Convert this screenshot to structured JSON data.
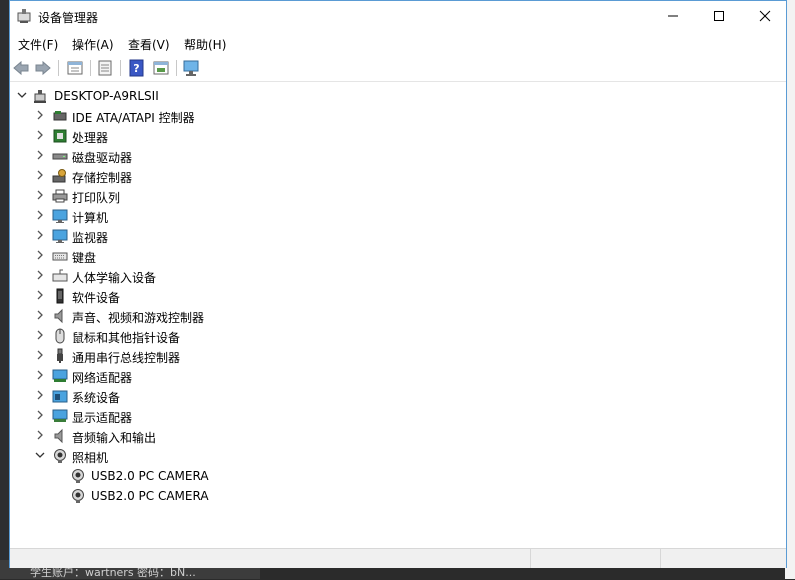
{
  "window": {
    "title": "设备管理器"
  },
  "menu": [
    "文件(F)",
    "操作(A)",
    "查看(V)",
    "帮助(H)"
  ],
  "toolbar_icons": [
    "back-icon",
    "forward-icon",
    "properties-view-icon",
    "document-icon",
    "help-icon",
    "update-driver-icon",
    "scan-hardware-icon"
  ],
  "tree": {
    "root": "DESKTOP-A9RLSII",
    "categories": [
      {
        "label": "IDE ATA/ATAPI 控制器",
        "icon": "ide-controller-icon",
        "expanded": false
      },
      {
        "label": "处理器",
        "icon": "processor-icon",
        "expanded": false
      },
      {
        "label": "磁盘驱动器",
        "icon": "disk-drive-icon",
        "expanded": false
      },
      {
        "label": "存储控制器",
        "icon": "storage-controller-icon",
        "expanded": false
      },
      {
        "label": "打印队列",
        "icon": "printer-icon",
        "expanded": false
      },
      {
        "label": "计算机",
        "icon": "computer-icon",
        "expanded": false
      },
      {
        "label": "监视器",
        "icon": "monitor-icon",
        "expanded": false
      },
      {
        "label": "键盘",
        "icon": "keyboard-icon",
        "expanded": false
      },
      {
        "label": "人体学输入设备",
        "icon": "hid-icon",
        "expanded": false
      },
      {
        "label": "软件设备",
        "icon": "software-device-icon",
        "expanded": false
      },
      {
        "label": "声音、视频和游戏控制器",
        "icon": "speaker-icon",
        "expanded": false
      },
      {
        "label": "鼠标和其他指针设备",
        "icon": "mouse-icon",
        "expanded": false
      },
      {
        "label": "通用串行总线控制器",
        "icon": "usb-icon",
        "expanded": false
      },
      {
        "label": "网络适配器",
        "icon": "network-adapter-icon",
        "expanded": false
      },
      {
        "label": "系统设备",
        "icon": "system-device-icon",
        "expanded": false
      },
      {
        "label": "显示适配器",
        "icon": "display-adapter-icon",
        "expanded": false
      },
      {
        "label": "音频输入和输出",
        "icon": "audio-io-icon",
        "expanded": false
      },
      {
        "label": "照相机",
        "icon": "camera-icon",
        "expanded": true,
        "children": [
          "USB2.0 PC CAMERA",
          "USB2.0 PC CAMERA"
        ]
      }
    ]
  },
  "background": {
    "bottom_text": "学生账户：wartners 密码：bN..."
  },
  "colors": {
    "window_border": "#5a9bd4",
    "selection": "#cce8ff"
  }
}
